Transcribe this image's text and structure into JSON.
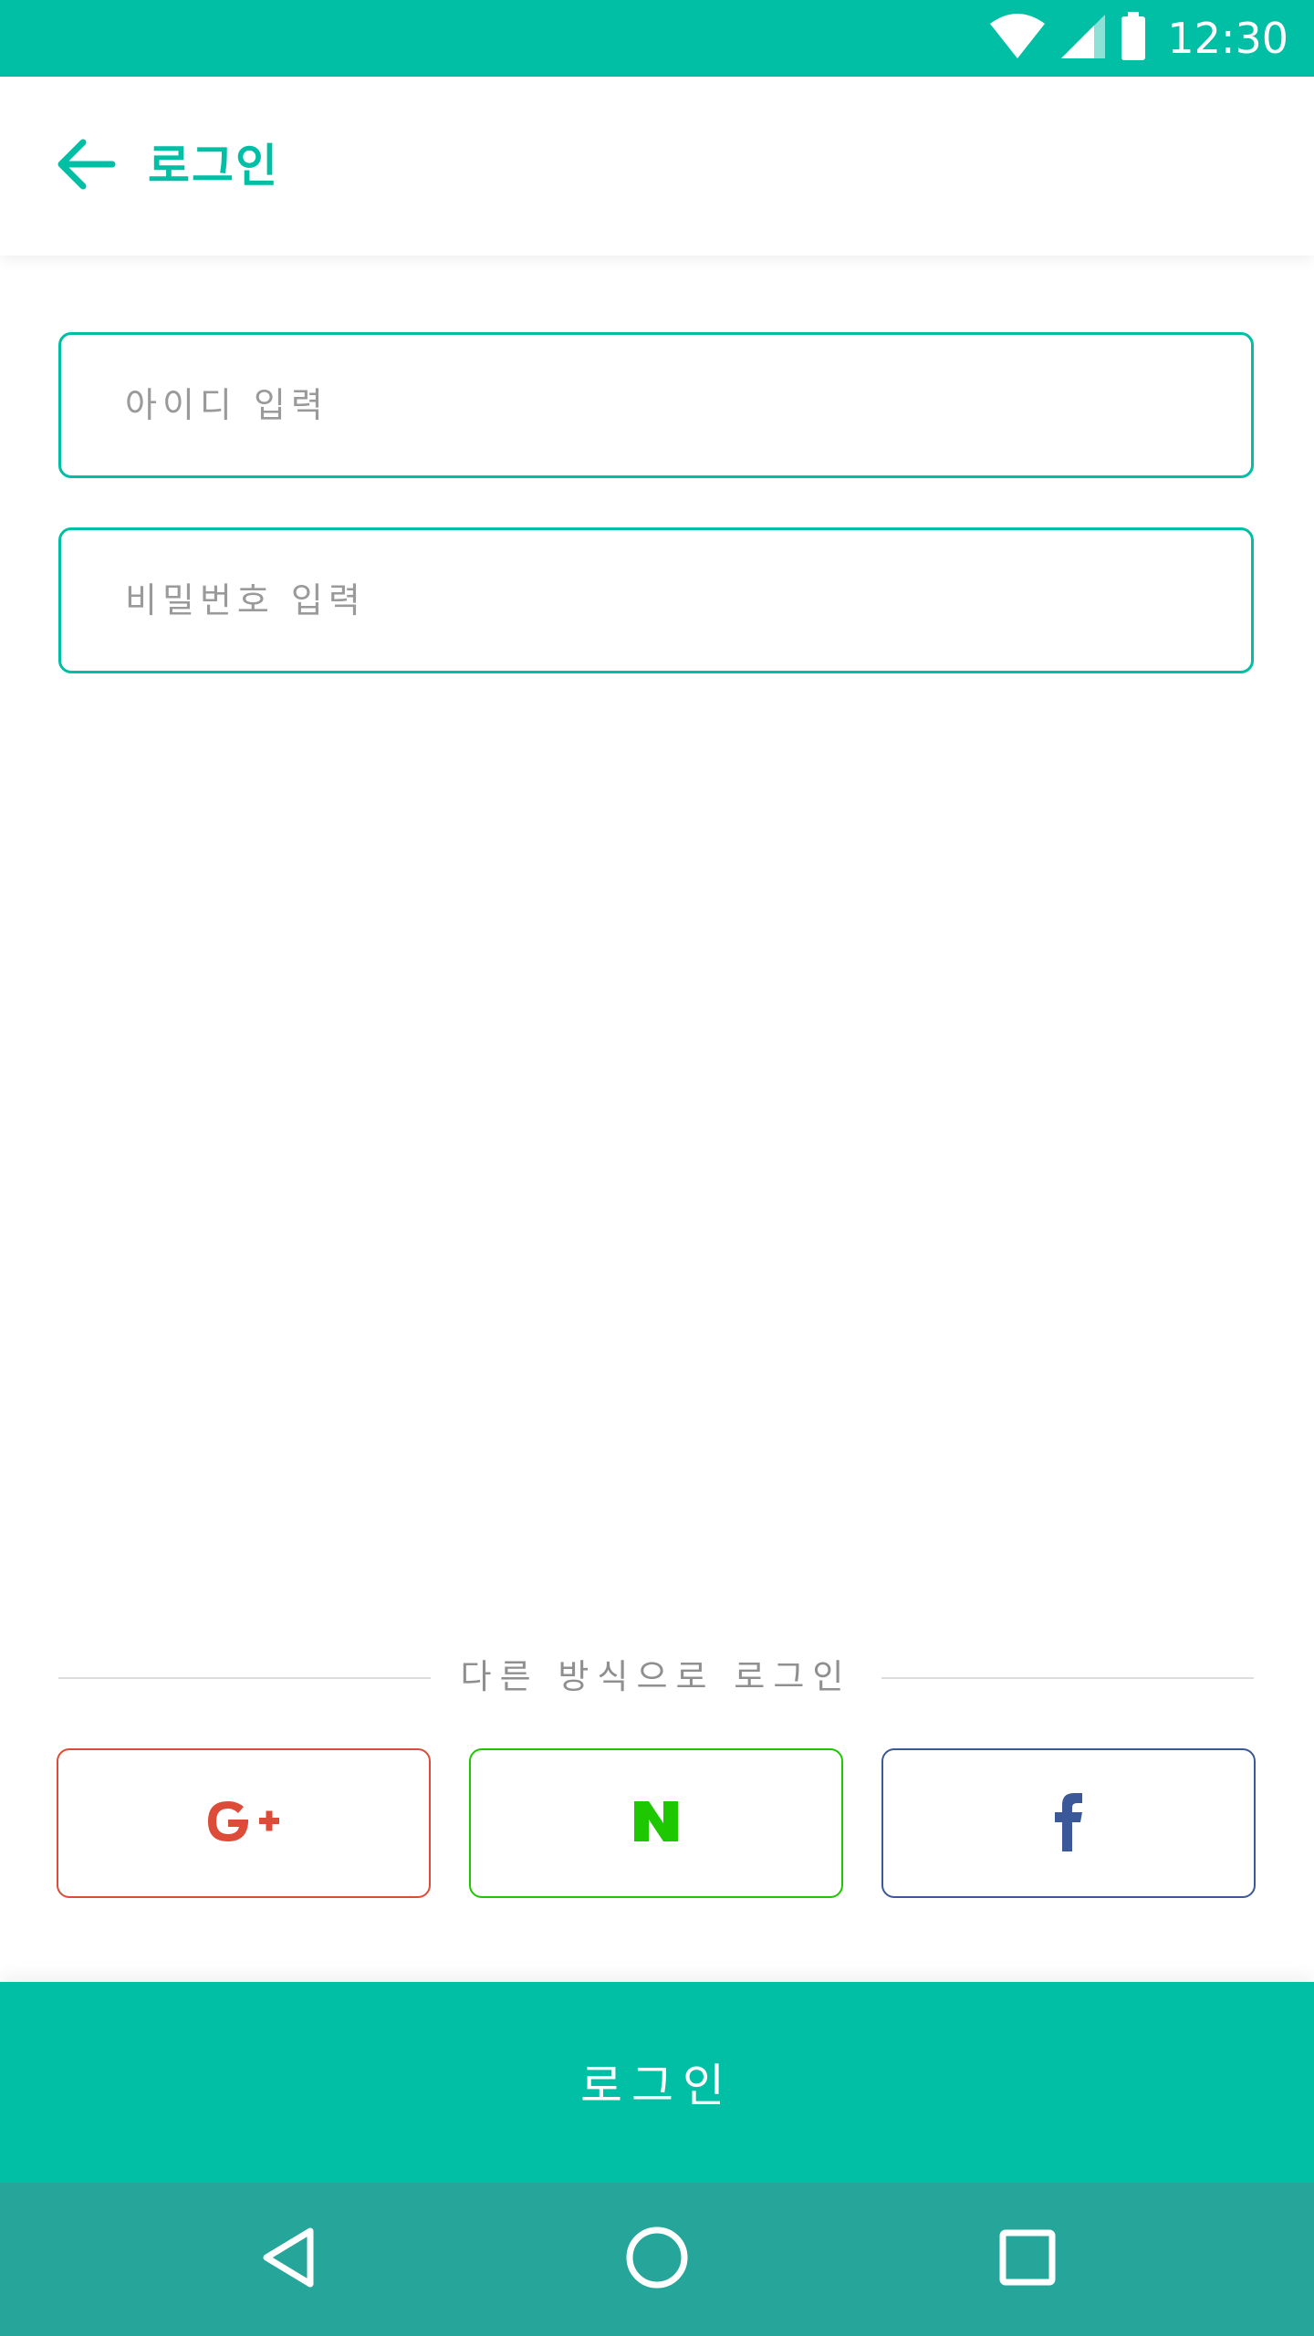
{
  "colors": {
    "brand": "#00BFA5",
    "navbar": "#26A69A",
    "google": "#DD4B39",
    "naver": "#1EC800",
    "facebook": "#3B5998"
  },
  "status_bar": {
    "time": "12:30",
    "icons": [
      "wifi-icon",
      "signal-icon",
      "battery-icon"
    ]
  },
  "app_bar": {
    "back_icon": "arrow-left-icon",
    "title": "로그인"
  },
  "form": {
    "id_placeholder": "아이디 입력",
    "password_placeholder": "비밀번호 입력"
  },
  "alt_login": {
    "label": "다른 방식으로 로그인",
    "providers": [
      {
        "name": "google",
        "icon": "google-plus-icon",
        "glyph": "G+"
      },
      {
        "name": "naver",
        "icon": "naver-icon",
        "glyph": "N"
      },
      {
        "name": "facebook",
        "icon": "facebook-icon",
        "glyph": "f"
      }
    ]
  },
  "login_button": {
    "label": "로그인"
  },
  "nav_bar": {
    "icons": [
      "nav-back-icon",
      "nav-home-icon",
      "nav-recent-apps-icon"
    ]
  }
}
